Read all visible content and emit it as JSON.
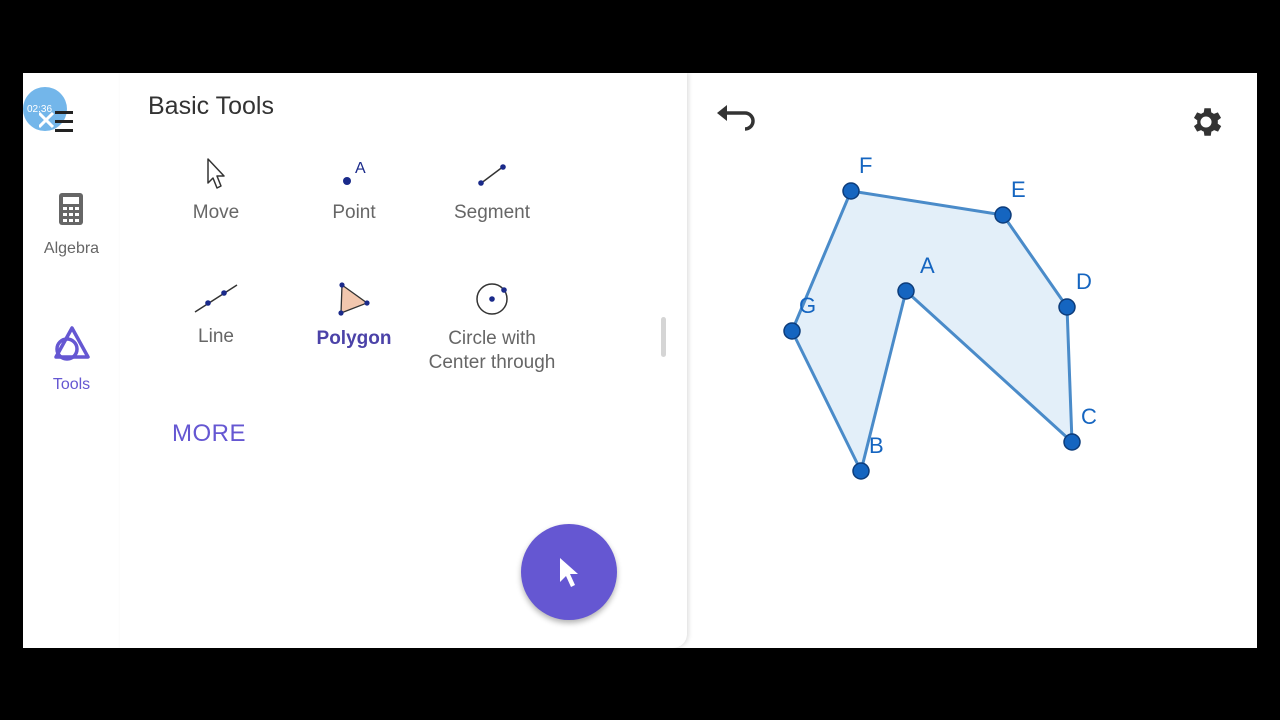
{
  "rail": {
    "avatar_text": "02:36",
    "items": [
      {
        "label": "Algebra",
        "icon": "calculator-icon"
      },
      {
        "label": "Tools",
        "icon": "tools-shapes-icon"
      }
    ]
  },
  "panel": {
    "title": "Basic Tools",
    "tools": [
      {
        "label": "Move",
        "icon": "move-cursor-icon"
      },
      {
        "label": "Point",
        "icon": "point-icon",
        "icon_letter": "A"
      },
      {
        "label": "Segment",
        "icon": "segment-icon"
      },
      {
        "label": "Line",
        "icon": "line-icon"
      },
      {
        "label": "Polygon",
        "icon": "polygon-icon",
        "selected": true
      },
      {
        "label": "Circle with Center through",
        "label_line1": "Circle with",
        "label_line2": "Center through",
        "icon": "circle-center-icon"
      }
    ],
    "more_label": "MORE"
  },
  "graphics": {
    "points": [
      "A",
      "B",
      "C",
      "D",
      "E",
      "F",
      "G"
    ],
    "polygon_order": [
      "F",
      "E",
      "D",
      "C",
      "A",
      "B",
      "G"
    ]
  },
  "colors": {
    "accent": "#6557d2",
    "point_fill": "#1565c0",
    "polygon_stroke": "#4a8bc9",
    "polygon_fill": "#e3eff9"
  }
}
